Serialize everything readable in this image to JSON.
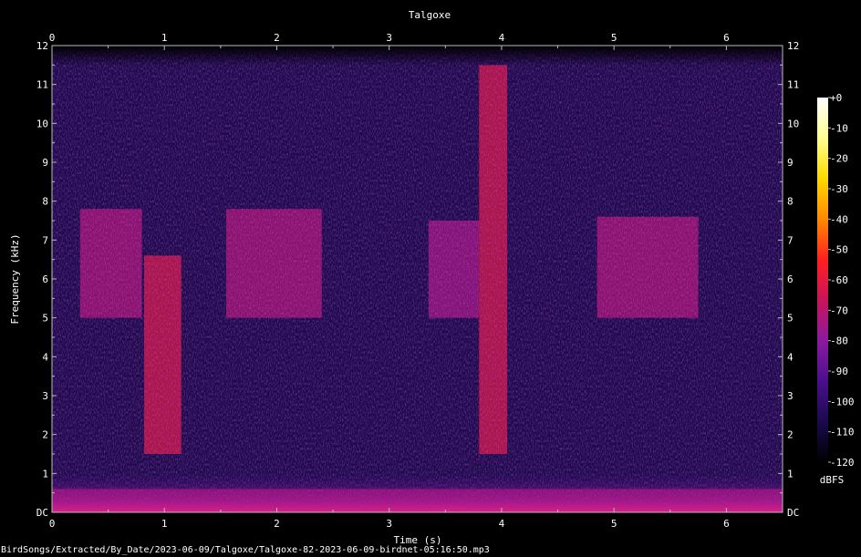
{
  "chart_data": {
    "type": "heatmap",
    "title": "Talgoxe",
    "xlabel": "Time (s)",
    "ylabel": "Frequency (kHz)",
    "xlim": [
      0,
      6.5
    ],
    "ylim": [
      0,
      12
    ],
    "x_ticks": [
      0,
      1,
      2,
      3,
      4,
      5,
      6
    ],
    "x_tick_labels": [
      "0",
      "1",
      "2",
      "3",
      "4",
      "5",
      "6"
    ],
    "y_ticks": [
      0,
      1,
      2,
      3,
      4,
      5,
      6,
      7,
      8,
      9,
      10,
      11,
      12
    ],
    "y_tick_labels": [
      "DC",
      "1",
      "2",
      "3",
      "4",
      "5",
      "6",
      "7",
      "8",
      "9",
      "10",
      "11",
      "12"
    ],
    "colorbar": {
      "label": "dBFS",
      "range": [
        -120,
        0
      ],
      "ticks": [
        0,
        -10,
        -20,
        -30,
        -40,
        -50,
        -60,
        -70,
        -80,
        -90,
        -100,
        -110,
        -120
      ],
      "tick_labels": [
        "+0",
        "-10",
        "-20",
        "-30",
        "-40",
        "-50",
        "-60",
        "-70",
        "-80",
        "-90",
        "-100",
        "-110",
        "-120"
      ],
      "colors": [
        "#000000",
        "#1a0a4d",
        "#4b0f8c",
        "#8a1aa0",
        "#c8145a",
        "#ff2020",
        "#ff8a00",
        "#ffd800",
        "#ffff90",
        "#ffffff"
      ]
    },
    "background_color": "#1e0a4a",
    "events": [
      {
        "t_start": 0.82,
        "t_end": 1.15,
        "f_low": 1.5,
        "f_high": 6.6,
        "level": -62
      },
      {
        "t_start": 0.25,
        "t_end": 0.8,
        "f_low": 5.0,
        "f_high": 7.8,
        "level": -72
      },
      {
        "t_start": 1.55,
        "t_end": 2.4,
        "f_low": 5.0,
        "f_high": 7.8,
        "level": -72
      },
      {
        "t_start": 3.8,
        "t_end": 4.05,
        "f_low": 1.5,
        "f_high": 11.5,
        "level": -62
      },
      {
        "t_start": 3.35,
        "t_end": 3.8,
        "f_low": 5.0,
        "f_high": 7.5,
        "level": -74
      },
      {
        "t_start": 4.85,
        "t_end": 5.75,
        "f_low": 5.0,
        "f_high": 7.6,
        "level": -72
      },
      {
        "t_start": 0,
        "t_end": 6.5,
        "f_low": 0,
        "f_high": 0.6,
        "level": -70
      }
    ],
    "grid": true,
    "legend": "none"
  },
  "footer_path": "BirdSongs/Extracted/By_Date/2023-06-09/Talgoxe/Talgoxe-82-2023-06-09-birdnet-05:16:50.mp3"
}
